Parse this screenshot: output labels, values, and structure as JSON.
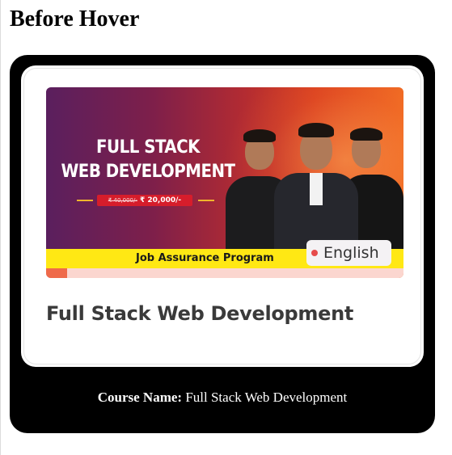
{
  "page": {
    "title": "Before Hover"
  },
  "card": {
    "thumbnail": {
      "banner_line1": "FULL STACK",
      "banner_line2": "WEB DEVELOPMENT",
      "price_old": "₹ 40,000/-",
      "price_new": "₹ 20,000/-",
      "ribbon_text": "Job Assurance Program",
      "language": "English"
    },
    "heading": "Full Stack Web Development",
    "caption": {
      "label": "Course Name:",
      "value": "Full Stack Web Development"
    }
  },
  "colors": {
    "card_background": "#000000",
    "ribbon": "#ffe814",
    "price_tag": "#d61d2b",
    "language_dot": "#e64b4b"
  }
}
